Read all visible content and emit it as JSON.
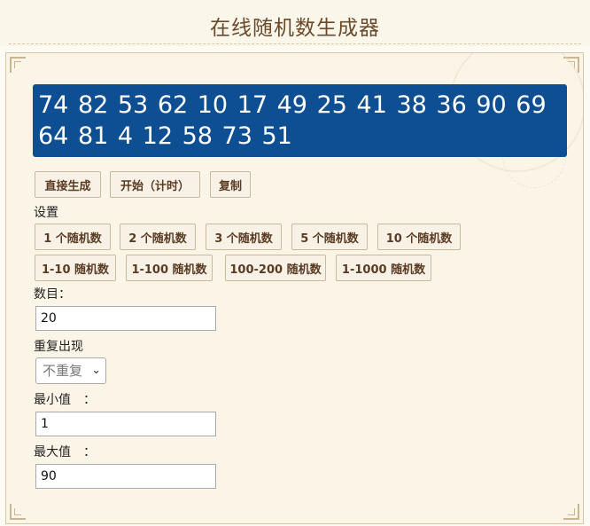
{
  "header": {
    "title": "在线随机数生成器"
  },
  "result": {
    "text": "74 82 53 62 10 17 49 25 41 38 36 90 69 64 81 4 12 58 73 51"
  },
  "actions": {
    "generate": "直接生成",
    "start_timed": "开始（计时）",
    "copy": "复制"
  },
  "settings": {
    "heading": "设置",
    "presets": [
      "1 个随机数",
      "2 个随机数",
      "3 个随机数",
      "5 个随机数",
      "10 个随机数",
      "1-10 随机数",
      "1-100 随机数",
      "100-200 随机数",
      "1-1000 随机数"
    ]
  },
  "form": {
    "count_label": "数目：",
    "count_value": "20",
    "repeat_label": "重复出现",
    "repeat_selected": "不重复",
    "min_label": "最小值　：",
    "min_value": "1",
    "max_label": "最大值　：",
    "max_value": "90"
  },
  "colors": {
    "accent": "#0d4f92",
    "title": "#6b4a2a",
    "button_text": "#5a3b24"
  }
}
